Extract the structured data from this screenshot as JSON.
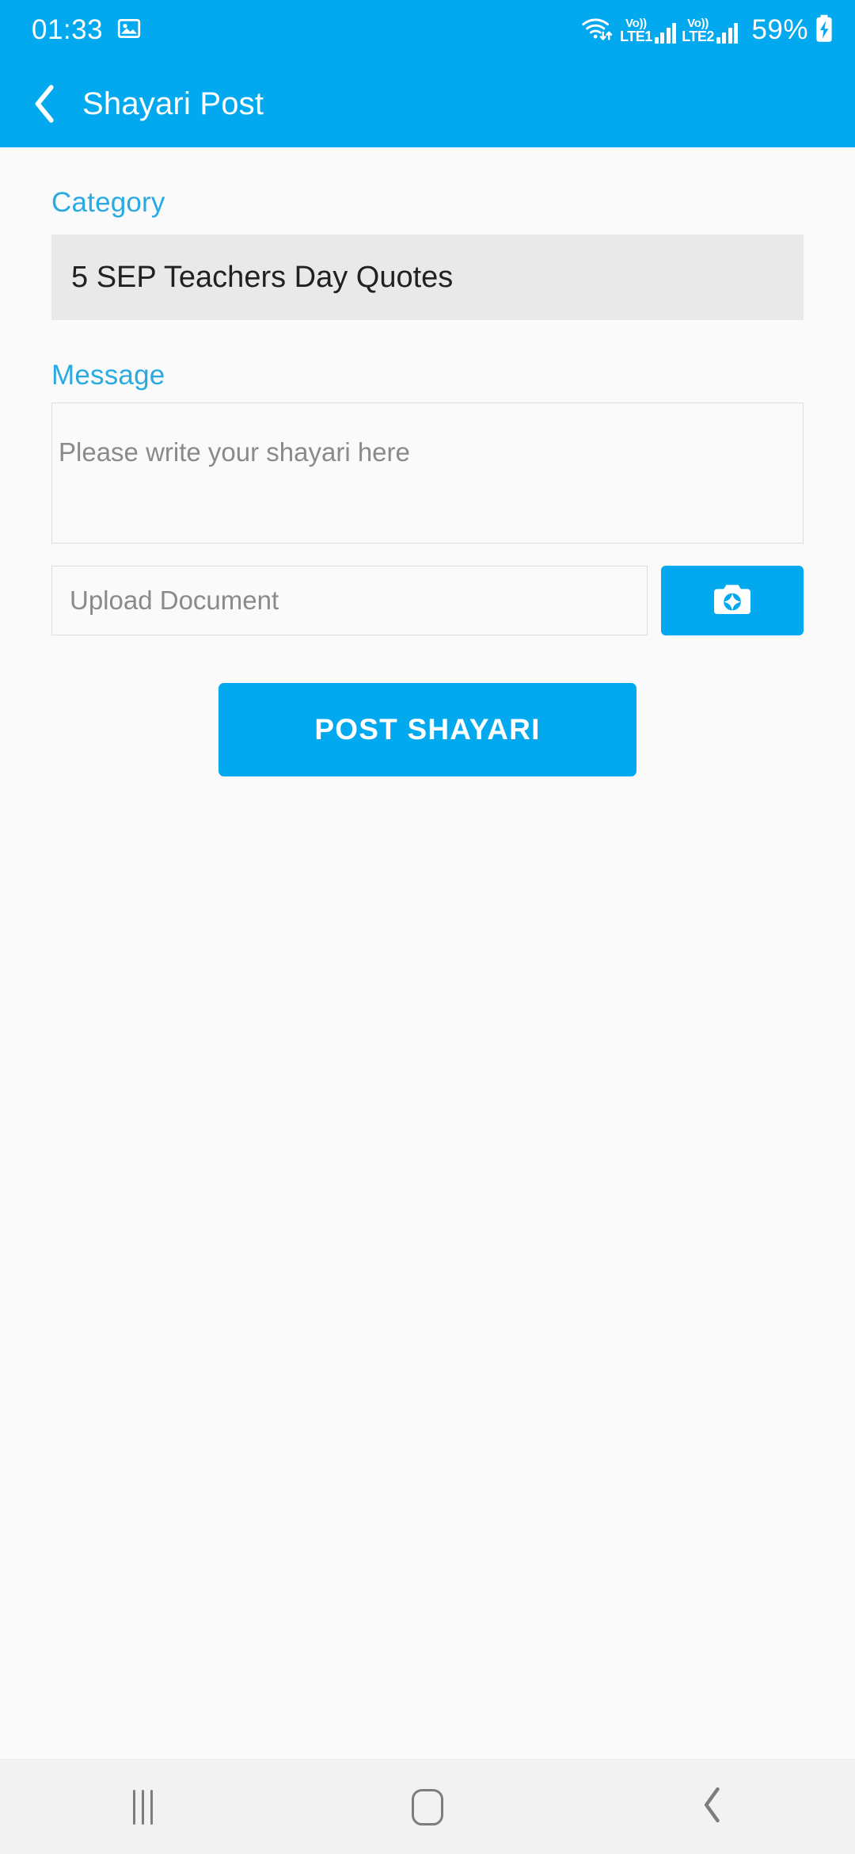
{
  "status_bar": {
    "time": "01:33",
    "gallery_icon": "image-icon",
    "wifi_icon": "wifi-data-icon",
    "sim1": {
      "vo": "Vo))",
      "lte": "LTE1",
      "signal_icon": "signal-bars-icon"
    },
    "sim2": {
      "vo": "Vo))",
      "lte": "LTE2",
      "signal_icon": "signal-bars-icon"
    },
    "battery_percent": "59%",
    "battery_icon": "battery-charging-icon"
  },
  "toolbar": {
    "back_icon": "chevron-left-icon",
    "title": "Shayari Post"
  },
  "form": {
    "category": {
      "label": "Category",
      "value": "5 SEP Teachers Day Quotes"
    },
    "message": {
      "label": "Message",
      "placeholder": "Please write your shayari here",
      "value": ""
    },
    "upload": {
      "placeholder": "Upload Document",
      "value": "",
      "camera_icon": "camera-icon"
    },
    "submit_label": "POST SHAYARI"
  },
  "nav_bar": {
    "recents_icon": "recents-icon",
    "home_icon": "home-icon",
    "back_icon": "back-chevron-icon"
  },
  "colors": {
    "accent": "#03a9ee",
    "label": "#29abe2",
    "page_bg": "#fafafa",
    "category_bg": "#e9e9e9",
    "placeholder": "#8a8a8a"
  }
}
